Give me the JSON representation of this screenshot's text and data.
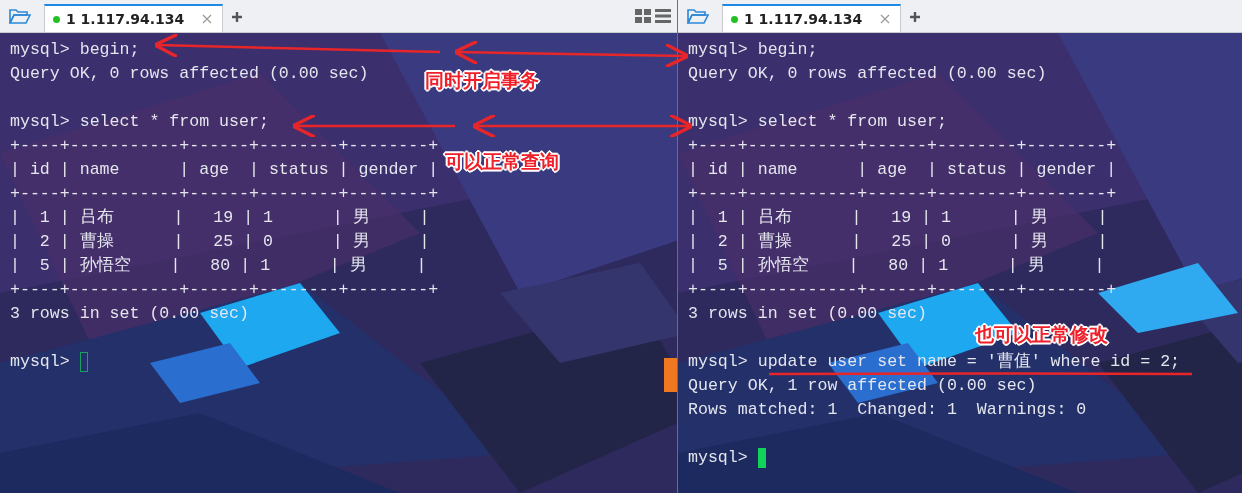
{
  "panes": [
    {
      "tab": {
        "label": "1 1.117.94.134",
        "selected": true,
        "connected": true
      },
      "layout_buttons": true,
      "focused": false,
      "lines": [
        {
          "kind": "text",
          "text": "mysql> begin;"
        },
        {
          "kind": "text",
          "text": "Query OK, 0 rows affected (0.00 sec)"
        },
        {
          "kind": "blank"
        },
        {
          "kind": "text",
          "text": "mysql> select * from user;"
        },
        {
          "kind": "text",
          "text": "+----+-----------+------+--------+--------+"
        },
        {
          "kind": "text",
          "text": "| id | name      | age  | status | gender |"
        },
        {
          "kind": "text",
          "text": "+----+-----------+------+--------+--------+"
        },
        {
          "kind": "text",
          "text": "|  1 | 吕布      |   19 | 1      | 男     |"
        },
        {
          "kind": "text",
          "text": "|  2 | 曹操      |   25 | 0      | 男     |"
        },
        {
          "kind": "text",
          "text": "|  5 | 孙悟空    |   80 | 1      | 男     |"
        },
        {
          "kind": "text",
          "text": "+----+-----------+------+--------+--------+"
        },
        {
          "kind": "text",
          "text": "3 rows in set (0.00 sec)"
        },
        {
          "kind": "blank"
        },
        {
          "kind": "prompt",
          "text": "mysql>"
        }
      ]
    },
    {
      "tab": {
        "label": "1 1.117.94.134",
        "selected": true,
        "connected": true
      },
      "focused": true,
      "lines": [
        {
          "kind": "text",
          "text": "mysql> begin;"
        },
        {
          "kind": "text",
          "text": "Query OK, 0 rows affected (0.00 sec)"
        },
        {
          "kind": "blank"
        },
        {
          "kind": "text",
          "text": "mysql> select * from user;"
        },
        {
          "kind": "text",
          "text": "+----+-----------+------+--------+--------+"
        },
        {
          "kind": "text",
          "text": "| id | name      | age  | status | gender |"
        },
        {
          "kind": "text",
          "text": "+----+-----------+------+--------+--------+"
        },
        {
          "kind": "text",
          "text": "|  1 | 吕布      |   19 | 1      | 男     |"
        },
        {
          "kind": "text",
          "text": "|  2 | 曹操      |   25 | 0      | 男     |"
        },
        {
          "kind": "text",
          "text": "|  5 | 孙悟空    |   80 | 1      | 男     |"
        },
        {
          "kind": "text",
          "text": "+----+-----------+------+--------+--------+"
        },
        {
          "kind": "text",
          "text": "3 rows in set (0.00 sec)"
        },
        {
          "kind": "blank"
        },
        {
          "kind": "text",
          "text": "mysql> update user set name = '曹值' where id = 2;"
        },
        {
          "kind": "text",
          "text": "Query OK, 1 row affected (0.00 sec)"
        },
        {
          "kind": "text",
          "text": "Rows matched: 1  Changed: 1  Warnings: 0"
        },
        {
          "kind": "blank"
        },
        {
          "kind": "prompt",
          "text": "mysql>"
        }
      ]
    }
  ],
  "annotations": [
    "同时开启事务",
    "可以正常查询",
    "也可以正常修改"
  ]
}
